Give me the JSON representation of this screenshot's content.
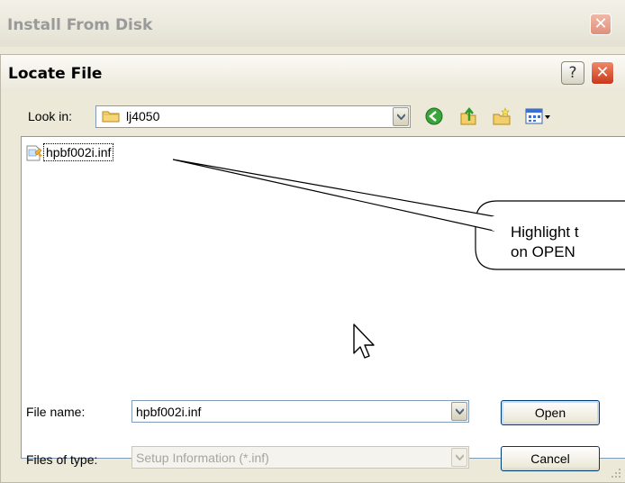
{
  "background_dialog": {
    "title": "Install From Disk"
  },
  "dialog": {
    "title": "Locate File",
    "help_label": "?",
    "close_label": "✕"
  },
  "toolbar": {
    "look_in_label": "Look in:",
    "look_in_value": "lj4050",
    "icons": [
      "back-icon",
      "up-folder-icon",
      "new-folder-icon",
      "views-menu-icon"
    ]
  },
  "file_list": {
    "items": [
      {
        "name": "hpbf002i.inf",
        "icon": "setup-information-file-icon"
      }
    ]
  },
  "file_name": {
    "label": "File name:",
    "value": "hpbf002i.inf"
  },
  "file_type": {
    "label": "Files of type:",
    "value": "Setup Information (*.inf)"
  },
  "buttons": {
    "open": "Open",
    "cancel": "Cancel"
  },
  "callout": {
    "line1": "Highlight t",
    "line2": "on OPEN"
  },
  "colors": {
    "accent": "#7f9db9",
    "close": "#c8391a",
    "dialog_bg": "#ece9d8"
  }
}
